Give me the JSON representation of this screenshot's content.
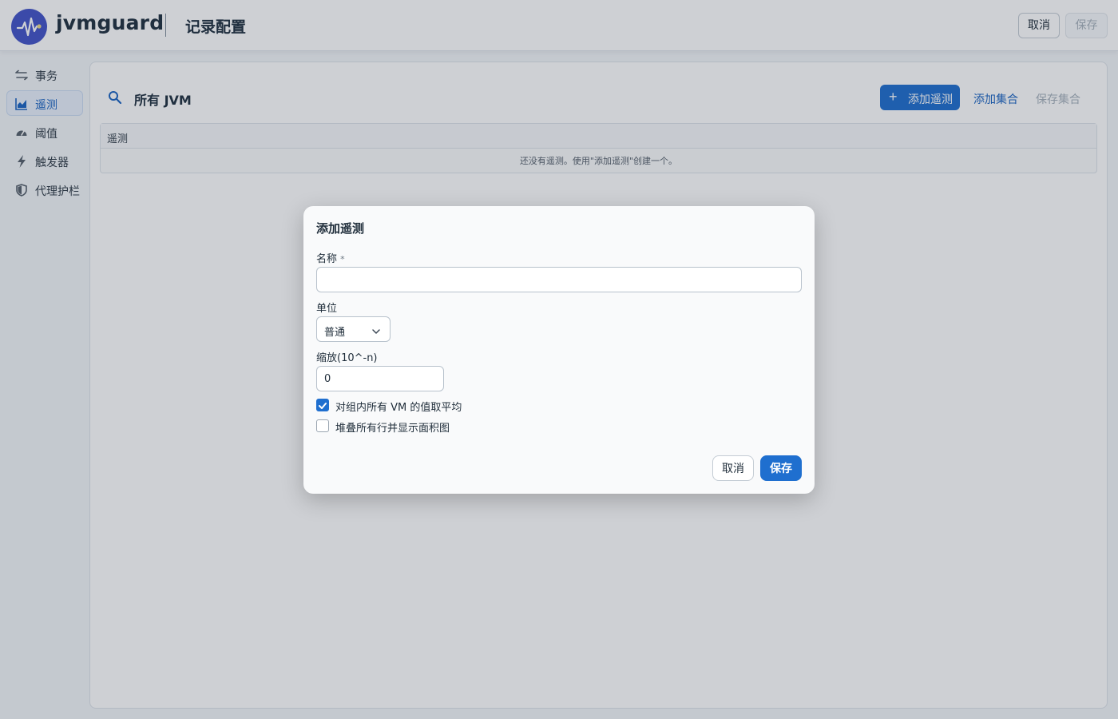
{
  "header": {
    "brand": "jvmguard",
    "title": "记录配置",
    "cancel_label": "取消",
    "save_label": "保存"
  },
  "sidebar": {
    "items": [
      {
        "label": "事务",
        "icon": "transactions-icon",
        "active": false
      },
      {
        "label": "遥测",
        "icon": "telemetry-chart-icon",
        "active": true
      },
      {
        "label": "阈值",
        "icon": "gauge-icon",
        "active": false
      },
      {
        "label": "触发器",
        "icon": "lightning-icon",
        "active": false
      },
      {
        "label": "代理护栏",
        "icon": "shield-icon",
        "active": false
      }
    ]
  },
  "main": {
    "scope_title": "所有 JVM",
    "add_telemetry_label": "添加遥测",
    "add_set_label": "添加集合",
    "save_set_label": "保存集合",
    "table": {
      "column_header": "遥测",
      "empty_text": "还没有遥测。使用\"添加遥测\"创建一个。"
    }
  },
  "modal": {
    "title": "添加遥测",
    "name_label": "名称",
    "required_mark": "*",
    "name_value": "",
    "unit_label": "单位",
    "unit_value": "普通",
    "scale_label": "缩放(10^-n)",
    "scale_value": "0",
    "average_checkbox": {
      "label": "对组内所有 VM 的值取平均",
      "checked": true
    },
    "stack_checkbox": {
      "label": "堆叠所有行并显示面积图",
      "checked": false
    },
    "cancel_label": "取消",
    "save_label": "保存"
  },
  "colors": {
    "primary": "#1f6fcf",
    "logo": "#4354c8",
    "disabled_text": "#a6b1bc"
  }
}
